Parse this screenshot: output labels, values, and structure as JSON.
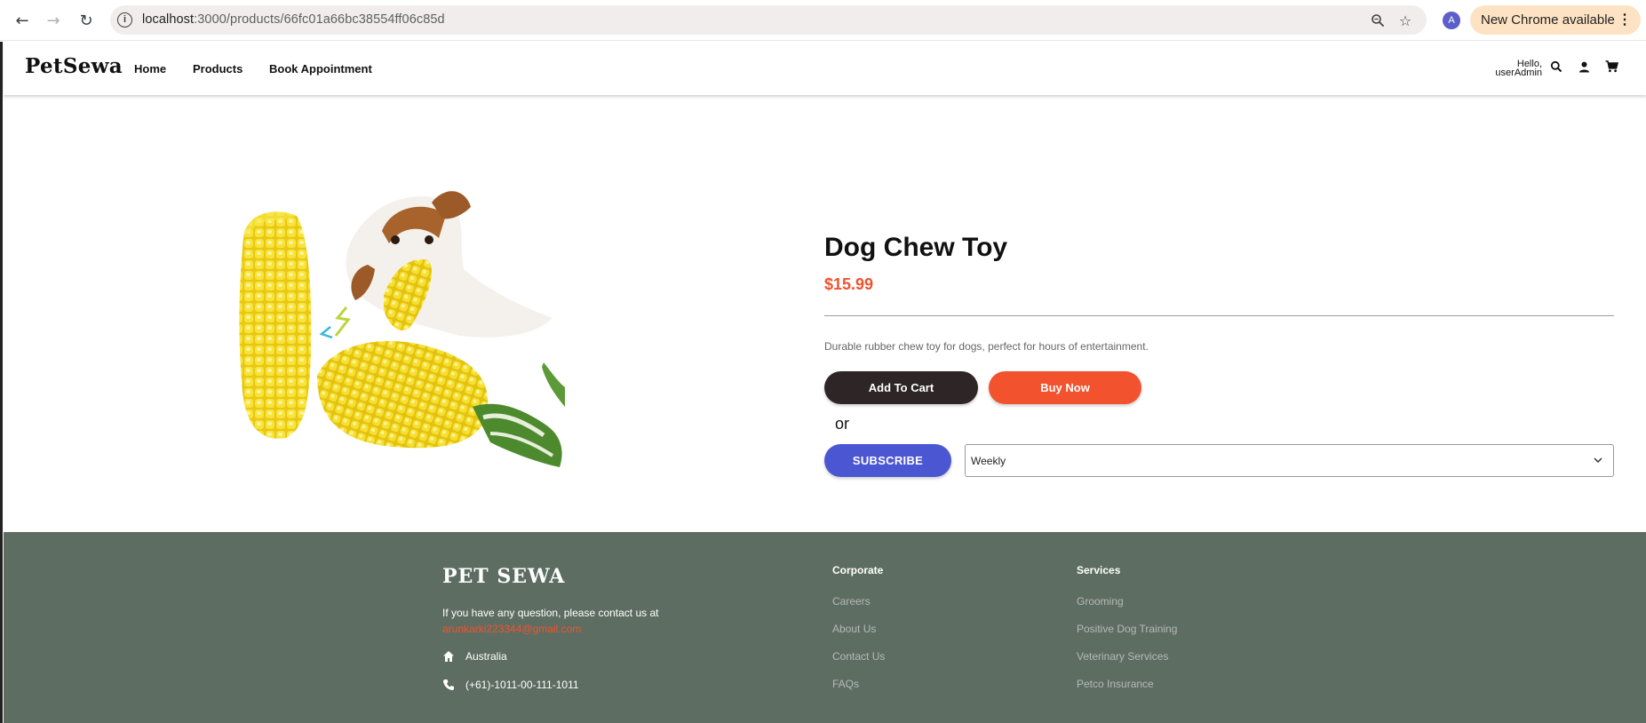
{
  "browser": {
    "url_host": "localhost",
    "url_rest": ":3000/products/66fc01a66bc38554ff06c85d",
    "profile_initial": "A",
    "update_label": "New Chrome available"
  },
  "header": {
    "logo": "PetSewa",
    "nav": [
      "Home",
      "Products",
      "Book Appointment"
    ],
    "greeting_line1": "Hello,",
    "greeting_line2": "userAdmin"
  },
  "product": {
    "title": "Dog Chew Toy",
    "price": "$15.99",
    "description": "Durable rubber chew toy for dogs, perfect for hours of entertainment.",
    "add_to_cart_label": "Add To Cart",
    "buy_now_label": "Buy Now",
    "or_label": "or",
    "subscribe_label": "SUBSCRIBE",
    "subscription_value": "Weekly",
    "image_icon": "dog-chew-toy-image"
  },
  "footer": {
    "logo": "PET SEWA",
    "contact_text": "If you have any question, please contact us at",
    "email": "arunkarki223344@gmail.com",
    "location": "Australia",
    "phone": "(+61)-1011-00-111-1011",
    "corporate_heading": "Corporate",
    "corporate_links": [
      "Careers",
      "About Us",
      "Contact Us",
      "FAQs"
    ],
    "services_heading": "Services",
    "services_links": [
      "Grooming",
      "Positive Dog Training",
      "Veterinary Services",
      "Petco Insurance"
    ]
  },
  "colors": {
    "accent": "#f2522d",
    "dark_button": "#2e2626",
    "subscribe": "#4b56d2",
    "footer_bg": "#5e6d62"
  }
}
